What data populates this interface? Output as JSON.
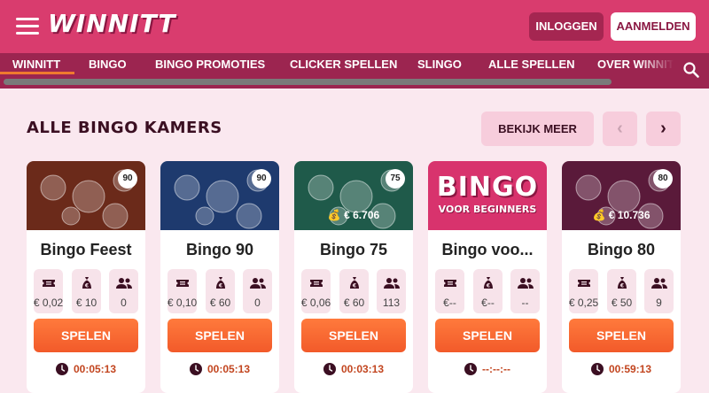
{
  "header": {
    "logo": "WINNITT",
    "login_label": "INLOGGEN",
    "register_label": "AANMELDEN"
  },
  "nav": {
    "items": [
      {
        "label": "WINNITT"
      },
      {
        "label": "BINGO"
      },
      {
        "label": "BINGO PROMOTIES"
      },
      {
        "label": "CLICKER SPELLEN"
      },
      {
        "label": "SLINGO"
      },
      {
        "label": "ALLE SPELLEN"
      },
      {
        "label": "OVER WINNITT"
      }
    ]
  },
  "section": {
    "title": "ALLE BINGO KAMERS",
    "more_label": "BEKIJK MEER",
    "prev_icon": "chevron-left-icon",
    "next_icon": "chevron-right-icon"
  },
  "cards": [
    {
      "name": "Bingo Feest",
      "badge": "90",
      "jackpot": "",
      "ticket": "€ 0,02",
      "prize": "€ 10",
      "players": "0",
      "play_label": "SPELEN",
      "timer": "00:05:13",
      "color": "#6b2a1a"
    },
    {
      "name": "Bingo 90",
      "badge": "90",
      "jackpot": "",
      "ticket": "€ 0,10",
      "prize": "€ 60",
      "players": "0",
      "play_label": "SPELEN",
      "timer": "00:05:13",
      "color": "#1e3a6e"
    },
    {
      "name": "Bingo 75",
      "badge": "75",
      "jackpot": "€ 6.706",
      "ticket": "€ 0,06",
      "prize": "€ 60",
      "players": "113",
      "play_label": "SPELEN",
      "timer": "00:03:13",
      "color": "#1f5a4a"
    },
    {
      "name": "Bingo voo...",
      "badge": "",
      "jackpot": "",
      "ticket": "€--",
      "prize": "€--",
      "players": "--",
      "play_label": "SPELEN",
      "timer": "--:--:--",
      "color": "#d8336d",
      "banner_line1": "BINGO",
      "banner_line2": "VOOR BEGINNERS"
    },
    {
      "name": "Bingo 80",
      "badge": "80",
      "jackpot": "€ 10.736",
      "ticket": "€ 0,25",
      "prize": "€ 50",
      "players": "9",
      "play_label": "SPELEN",
      "timer": "00:59:13",
      "color": "#5a1a3a"
    }
  ],
  "icons": {
    "menu": "hamburger-icon",
    "search": "search-icon",
    "ticket": "ticket-icon",
    "prize": "money-bag-icon",
    "players": "users-icon",
    "clock": "clock-icon"
  }
}
